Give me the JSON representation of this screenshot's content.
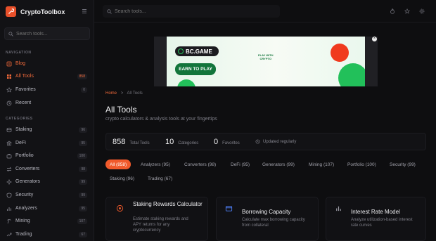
{
  "app": {
    "name": "CryptoToolbox"
  },
  "sidebar": {
    "search_placeholder": "Search tools...",
    "navigation_title": "NAVIGATION",
    "categories_title": "CATEGORIES",
    "nav": [
      {
        "label": "Blog",
        "count": ""
      },
      {
        "label": "All Tools",
        "count": "858"
      },
      {
        "label": "Favorites",
        "count": "0"
      },
      {
        "label": "Recent",
        "count": ""
      }
    ],
    "categories": [
      {
        "label": "Staking",
        "count": "96"
      },
      {
        "label": "DeFi",
        "count": "95"
      },
      {
        "label": "Portfolio",
        "count": "100"
      },
      {
        "label": "Converters",
        "count": "98"
      },
      {
        "label": "Generators",
        "count": "99"
      },
      {
        "label": "Security",
        "count": "99"
      },
      {
        "label": "Analyzers",
        "count": "95"
      },
      {
        "label": "Mining",
        "count": "107"
      },
      {
        "label": "Trading",
        "count": "67"
      }
    ]
  },
  "topbar": {
    "search_placeholder": "Search tools..."
  },
  "ad": {
    "brand": "BC.GAME",
    "cta": "EARN TO PLAY",
    "tag1": "PLAY WITH",
    "tag2": "CRYPTO",
    "colors": {
      "bg": "#eef8f0",
      "accent": "#16b864",
      "red": "#f03a1e"
    }
  },
  "breadcrumb": {
    "home": "Home",
    "sep": ">",
    "current": "All Tools"
  },
  "page": {
    "title": "All Tools",
    "subtitle": "crypto calculators & analysis tools at your fingertips"
  },
  "stats": [
    {
      "num": "858",
      "label": "Total Tools"
    },
    {
      "num": "10",
      "label": "Categories"
    },
    {
      "num": "0",
      "label": "Favorites"
    }
  ],
  "stats_extra": "Updated regularly",
  "filters": [
    "All (858)",
    "Analyzers (95)",
    "Converters (98)",
    "DeFi (95)",
    "Generators (99)",
    "Mining (107)",
    "Portfolio (100)",
    "Security (99)",
    "Staking (96)",
    "Trading (67)"
  ],
  "cards": [
    {
      "title": "Staking Rewards Calculator",
      "desc": "Estimate staking rewards and APY returns for any cryptocurrency",
      "icon": "target-icon"
    },
    {
      "title": "Borrowing Capacity",
      "desc": "Calculate max borrowing capacity from collateral",
      "icon": "bank-icon"
    },
    {
      "title": "Interest Rate Model",
      "desc": "Analyze utilization-based interest rate curves",
      "icon": "bar-chart-icon"
    }
  ],
  "colors": {
    "accent": "#f15a2b",
    "bg": "#0e0e10",
    "sidebar": "#121215"
  }
}
